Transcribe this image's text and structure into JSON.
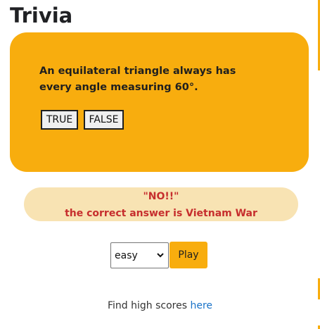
{
  "page": {
    "title": "Trivia"
  },
  "question": {
    "text": "An equilateral triangle always has every angle measuring 60°.",
    "answers": [
      "TRUE",
      "FALSE"
    ]
  },
  "feedback": {
    "line1": "\"NO!!\"",
    "line2": "the correct answer is Vietnam War"
  },
  "controls": {
    "difficulty_selected": "easy",
    "play_label": "Play"
  },
  "footer": {
    "prefix": "Find high scores ",
    "link_text": "here"
  },
  "colors": {
    "accent": "#f8ad0e",
    "feedback_bg": "#f8e3b3",
    "feedback_text": "#c62e2e",
    "link": "#1a73c8"
  }
}
